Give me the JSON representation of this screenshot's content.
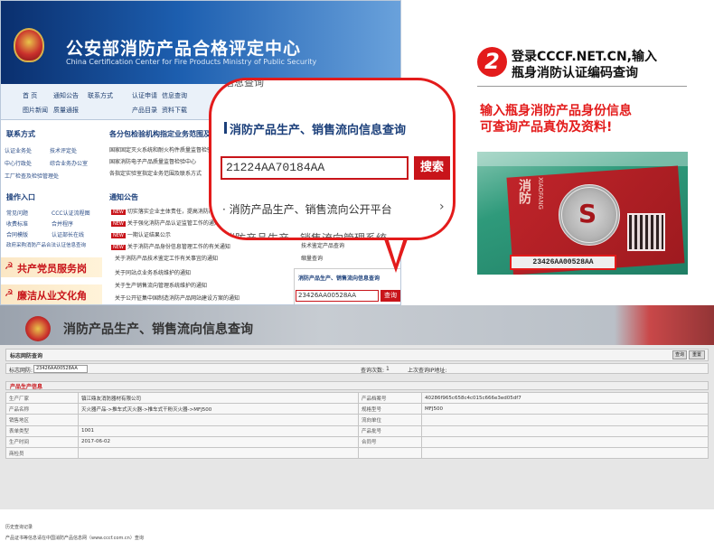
{
  "site": {
    "title": "公安部消防产品合格评定中心",
    "subtitle": "China Certification Center for Fire Products Ministry of Public Security",
    "nav": [
      "首 页",
      "通知公告",
      "联系方式",
      "认证申请",
      "信息查询",
      "图片新闻",
      "质量通报",
      "产品目录",
      "资料下载"
    ],
    "left_sections": {
      "contact": "联系方式",
      "contact_items": [
        "认证业务处",
        "技术评定处",
        "中心行政处",
        "综合业务办公室",
        "工厂检查及检验管理处"
      ],
      "guide": "操作入口",
      "guide_items": [
        "常见问题",
        "CCC认证流程图",
        "收费标准",
        "合并程序",
        "合同模版",
        "认证部长在线",
        "政府采购消防产品合法认证信息查询"
      ],
      "banner1": "共产党员服务岗",
      "banner2": "廉洁从业文化角"
    },
    "middle": {
      "heading": "各分包检验机构指定业务范围及联系方式",
      "links": [
        "国家固定灭火系统和耐火构件质量监督检验中心",
        "国家消防电子产品质量监督检验中心",
        "各指定实验室指定业务范围及联系方式"
      ],
      "notice_heading": "通知公告",
      "notices": [
        "切实落实企业主体责任，提高消防产品质量",
        "关于强化消防产品认证监管工作的通知",
        "一期认证结果公示",
        "关于消防产品身份信息管理工作的有关通知",
        "关于消防产品技术鉴定工作有关事宜的通知",
        "关于同站点业务系统维护的通知",
        "关于生产销售流向管理系统维护的通知",
        "关于公开征集中国制造消防产品网站建设方案的通知"
      ],
      "badge_new": "NEW"
    },
    "right_mini": {
      "items": [
        "技术鉴定产品查询",
        "缩量查询"
      ],
      "heading": "消防产品生产、销售流向信息查询",
      "input_value": "23426AA00528AA",
      "button": "查询"
    }
  },
  "bubble": {
    "top_cut": "信息查询",
    "heading": "消防产品生产、销售流向信息查询",
    "input_value": "21224AA70184AA",
    "button": "搜索",
    "link": "· 消防产品生产、销售流向公开平台",
    "chevron": "›",
    "cut_text": "消防产品生产、销售流向管理系统"
  },
  "instructions": {
    "number": "2",
    "line1": "登录CCCF.NET.CN,输入",
    "line2": "瓶身消防认证编码查询",
    "tip1": "输入瓶身消防产品身份信息",
    "tip2": "可查询产品真伪及资料!"
  },
  "photo": {
    "brand_cn": "消防",
    "brand_en": "XIAOFANG",
    "seal_letter": "S",
    "serial": "23426AA00528AA"
  },
  "result": {
    "title": "消防产品生产、销售流向信息查询",
    "subbar": "标志网防查询",
    "btn_query": "查询",
    "btn_reset": "重置",
    "q_label": "标志网防:",
    "q_value": "23426AA00528AA",
    "count_label": "查询次数:",
    "count_value": "1",
    "last_label": "上次查询IP地址:",
    "info_heading": "产品生产信息",
    "rows": [
      {
        "k": "生产厂家",
        "v": "镇江鼎友消防器材有限公司",
        "k2": "产品档案号",
        "v2": "40286f965c658c4c015c666e3ed05df7"
      },
      {
        "k": "产品名称",
        "v": "灭火器产品->推车式灭火器->推车式干粉灭火器->MFJ500",
        "k2": "规格型号",
        "v2": "MFJ500"
      },
      {
        "k": "销售地区",
        "v": "",
        "k2": "流向单位",
        "v2": ""
      },
      {
        "k": "表单类型",
        "v": "1001",
        "k2": "产品批号",
        "v2": ""
      },
      {
        "k": "生产时间",
        "v": "2017-06-02",
        "k2": "合同号",
        "v2": ""
      },
      {
        "k": "商检员",
        "v": "",
        "k2": "",
        "v2": ""
      }
    ],
    "footnote": "历史查询记录",
    "footer": "产品证书等信息请在中国消防产品信息网（www.cccf.com.cn）查询"
  },
  "colors": {
    "accent_red": "#e31b1b",
    "brand_blue": "#1b3f7a"
  }
}
